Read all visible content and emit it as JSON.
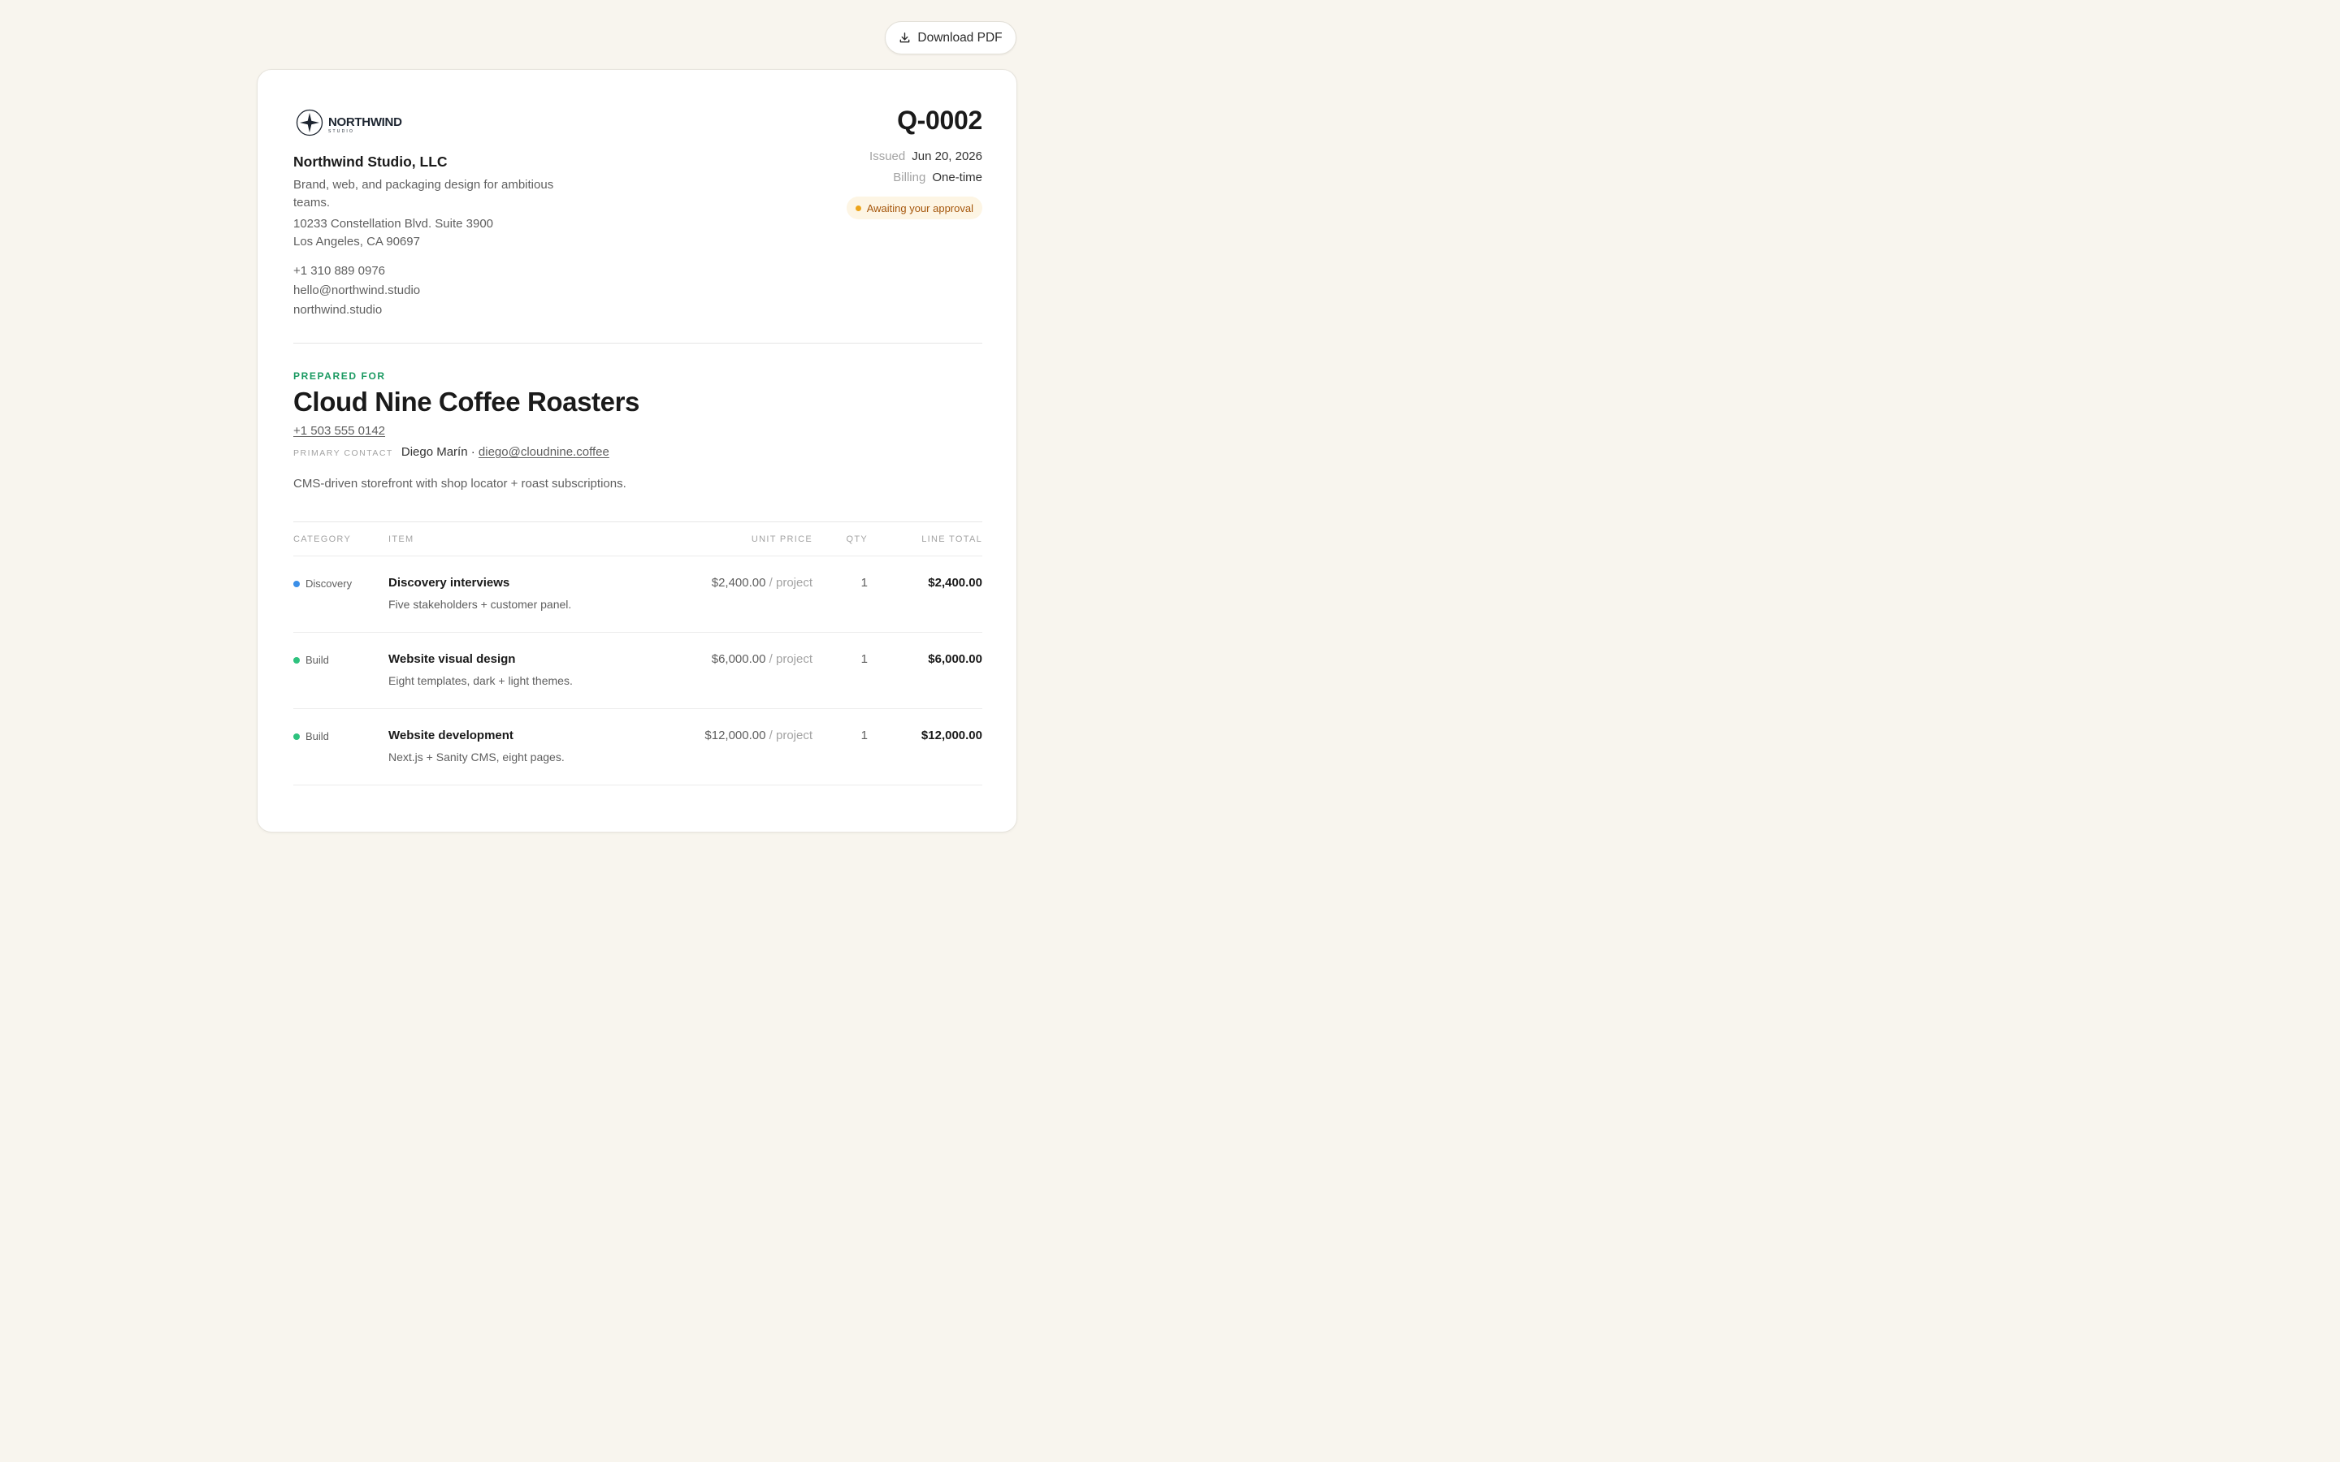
{
  "toolbar": {
    "download_label": "Download PDF"
  },
  "company": {
    "logo_name": "NORTHWIND",
    "logo_sub": "STUDIO",
    "name": "Northwind Studio, LLC",
    "tagline": "Brand, web, and packaging design for ambitious teams.",
    "address_line1": "10233 Constellation Blvd. Suite 3900",
    "address_line2": "Los Angeles, CA 90697",
    "phone": "+1 310 889 0976",
    "email": "hello@northwind.studio",
    "website": "northwind.studio"
  },
  "quote": {
    "number": "Q-0002",
    "issued_label": "Issued",
    "issued_value": "Jun 20, 2026",
    "billing_label": "Billing",
    "billing_value": "One-time",
    "status": "Awaiting your approval"
  },
  "client": {
    "prepared_label": "PREPARED FOR",
    "name": "Cloud Nine Coffee Roasters",
    "phone": "+1 503 555 0142",
    "contact_label": "PRIMARY CONTACT",
    "contact_name": "Diego Marín",
    "separator": "·",
    "contact_email": "diego@cloudnine.coffee",
    "project_description": "CMS-driven storefront with shop locator + roast subscriptions."
  },
  "table": {
    "headers": {
      "category": "CATEGORY",
      "item": "ITEM",
      "unit_price": "UNIT PRICE",
      "qty": "QTY",
      "line_total": "LINE TOTAL"
    },
    "rows": [
      {
        "category": "Discovery",
        "category_color": "#3b8fe8",
        "title": "Discovery interviews",
        "description": "Five stakeholders + customer panel.",
        "unit_price": "$2,400.00",
        "unit_suffix": "/ project",
        "qty": "1",
        "line_total": "$2,400.00"
      },
      {
        "category": "Build",
        "category_color": "#2ec27e",
        "title": "Website visual design",
        "description": "Eight templates, dark + light themes.",
        "unit_price": "$6,000.00",
        "unit_suffix": "/ project",
        "qty": "1",
        "line_total": "$6,000.00"
      },
      {
        "category": "Build",
        "category_color": "#2ec27e",
        "title": "Website development",
        "description": "Next.js + Sanity CMS, eight pages.",
        "unit_price": "$12,000.00",
        "unit_suffix": "/ project",
        "qty": "1",
        "line_total": "$12,000.00"
      }
    ]
  },
  "colors": {
    "page_background": "#f8f5ee",
    "accent_green": "#1b9a62",
    "status_text": "#a5560b",
    "status_background": "#fdf5e4"
  }
}
